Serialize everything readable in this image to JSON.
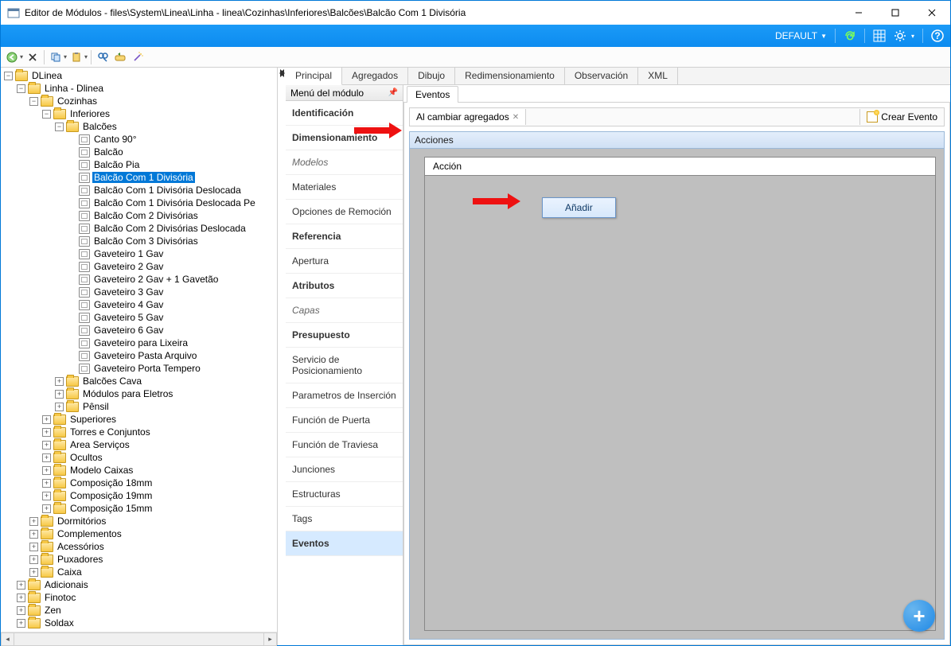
{
  "title": "Editor de Módulos - files\\System\\Linea\\Linha - linea\\Cozinhas\\Inferiores\\Balcões\\Balcão Com 1 Divisória",
  "ribbon": {
    "default_label": "DEFAULT"
  },
  "toptabs": {
    "items": [
      "Principal",
      "Agregados",
      "Dibujo",
      "Redimensionamiento",
      "Observación",
      "XML"
    ],
    "active": 0
  },
  "modmenu": {
    "title": "Menú del módulo",
    "items": [
      {
        "label": "Identificación",
        "style": "bold"
      },
      {
        "label": "Dimensionamiento",
        "style": "bold"
      },
      {
        "label": "Modelos",
        "style": "italic"
      },
      {
        "label": "Materiales",
        "style": ""
      },
      {
        "label": "Opciones de Remoción",
        "style": ""
      },
      {
        "label": "Referencia",
        "style": "bold"
      },
      {
        "label": "Apertura",
        "style": ""
      },
      {
        "label": "Atributos",
        "style": "bold"
      },
      {
        "label": "Capas",
        "style": "italic"
      },
      {
        "label": "Presupuesto",
        "style": "bold"
      },
      {
        "label": "Servicio de Posicionamiento",
        "style": ""
      },
      {
        "label": "Parametros de Inserción",
        "style": ""
      },
      {
        "label": "Función de Puerta",
        "style": ""
      },
      {
        "label": "Función de Traviesa",
        "style": ""
      },
      {
        "label": "Junciones",
        "style": ""
      },
      {
        "label": "Estructuras",
        "style": ""
      },
      {
        "label": "Tags",
        "style": ""
      },
      {
        "label": "Eventos",
        "style": "selected"
      }
    ]
  },
  "subtab": "Eventos",
  "eventbar": {
    "open_tab": "Al cambiar agregados",
    "create": "Crear Evento"
  },
  "acciones": {
    "group_label": "Acciones",
    "column": "Acción",
    "context_item": "Añadir"
  },
  "tree": {
    "root": {
      "label": "DLinea",
      "icon": "folder-open",
      "exp": "-",
      "children": [
        {
          "label": "Linha - Dlinea",
          "icon": "folder-open",
          "exp": "-",
          "children": [
            {
              "label": "Cozinhas",
              "icon": "folder-open",
              "exp": "-",
              "children": [
                {
                  "label": "Inferiores",
                  "icon": "folder-open",
                  "exp": "-",
                  "children": [
                    {
                      "label": "Balcões",
                      "icon": "folder-open",
                      "exp": "-",
                      "children": [
                        {
                          "label": "Canto 90°",
                          "icon": "module",
                          "exp": ""
                        },
                        {
                          "label": "Balcão",
                          "icon": "module",
                          "exp": ""
                        },
                        {
                          "label": "Balcão Pia",
                          "icon": "module",
                          "exp": ""
                        },
                        {
                          "label": "Balcão Com 1 Divisória",
                          "icon": "module",
                          "exp": "",
                          "selected": true
                        },
                        {
                          "label": "Balcão Com 1 Divisória Deslocada",
                          "icon": "module",
                          "exp": ""
                        },
                        {
                          "label": "Balcão Com 1 Divisória Deslocada Pe",
                          "icon": "module",
                          "exp": ""
                        },
                        {
                          "label": "Balcão Com 2 Divisórias",
                          "icon": "module",
                          "exp": ""
                        },
                        {
                          "label": "Balcão Com 2 Divisórias Deslocada",
                          "icon": "module",
                          "exp": ""
                        },
                        {
                          "label": "Balcão Com 3 Divisórias",
                          "icon": "module",
                          "exp": ""
                        },
                        {
                          "label": "Gaveteiro 1 Gav",
                          "icon": "module",
                          "exp": ""
                        },
                        {
                          "label": "Gaveteiro 2 Gav",
                          "icon": "module",
                          "exp": ""
                        },
                        {
                          "label": "Gaveteiro 2 Gav + 1 Gavetão",
                          "icon": "module",
                          "exp": ""
                        },
                        {
                          "label": "Gaveteiro 3 Gav",
                          "icon": "module",
                          "exp": ""
                        },
                        {
                          "label": "Gaveteiro 4 Gav",
                          "icon": "module",
                          "exp": ""
                        },
                        {
                          "label": "Gaveteiro 5 Gav",
                          "icon": "module",
                          "exp": ""
                        },
                        {
                          "label": "Gaveteiro 6 Gav",
                          "icon": "module",
                          "exp": ""
                        },
                        {
                          "label": "Gaveteiro para Lixeira",
                          "icon": "module",
                          "exp": ""
                        },
                        {
                          "label": "Gaveteiro Pasta Arquivo",
                          "icon": "module",
                          "exp": ""
                        },
                        {
                          "label": "Gaveteiro Porta Tempero",
                          "icon": "module",
                          "exp": ""
                        }
                      ]
                    },
                    {
                      "label": "Balcões Cava",
                      "icon": "folder-closed",
                      "exp": "+"
                    },
                    {
                      "label": "Módulos para Eletros",
                      "icon": "folder-closed",
                      "exp": "+"
                    },
                    {
                      "label": "Pênsil",
                      "icon": "folder-closed",
                      "exp": "+"
                    }
                  ]
                },
                {
                  "label": "Superiores",
                  "icon": "folder-closed",
                  "exp": "+"
                },
                {
                  "label": "Torres e Conjuntos",
                  "icon": "folder-closed",
                  "exp": "+"
                },
                {
                  "label": "Area Serviços",
                  "icon": "folder-closed",
                  "exp": "+"
                },
                {
                  "label": "Ocultos",
                  "icon": "folder-closed",
                  "exp": "+"
                },
                {
                  "label": "Modelo Caixas",
                  "icon": "folder-closed",
                  "exp": "+"
                },
                {
                  "label": "Composição 18mm",
                  "icon": "folder-closed",
                  "exp": "+"
                },
                {
                  "label": "Composição 19mm",
                  "icon": "folder-closed",
                  "exp": "+"
                },
                {
                  "label": "Composição 15mm",
                  "icon": "folder-closed",
                  "exp": "+"
                }
              ]
            },
            {
              "label": "Dormitórios",
              "icon": "folder-closed",
              "exp": "+"
            },
            {
              "label": "Complementos",
              "icon": "folder-closed",
              "exp": "+"
            },
            {
              "label": "Acessórios",
              "icon": "folder-closed",
              "exp": "+"
            },
            {
              "label": "Puxadores",
              "icon": "folder-closed",
              "exp": "+"
            },
            {
              "label": "Caixa",
              "icon": "folder-closed",
              "exp": "+"
            }
          ]
        },
        {
          "label": "Adicionais",
          "icon": "folder-closed",
          "exp": "+"
        },
        {
          "label": "Finotoc",
          "icon": "folder-closed",
          "exp": "+"
        },
        {
          "label": "Zen",
          "icon": "folder-closed",
          "exp": "+"
        },
        {
          "label": "Soldax",
          "icon": "folder-closed",
          "exp": "+"
        }
      ]
    }
  }
}
